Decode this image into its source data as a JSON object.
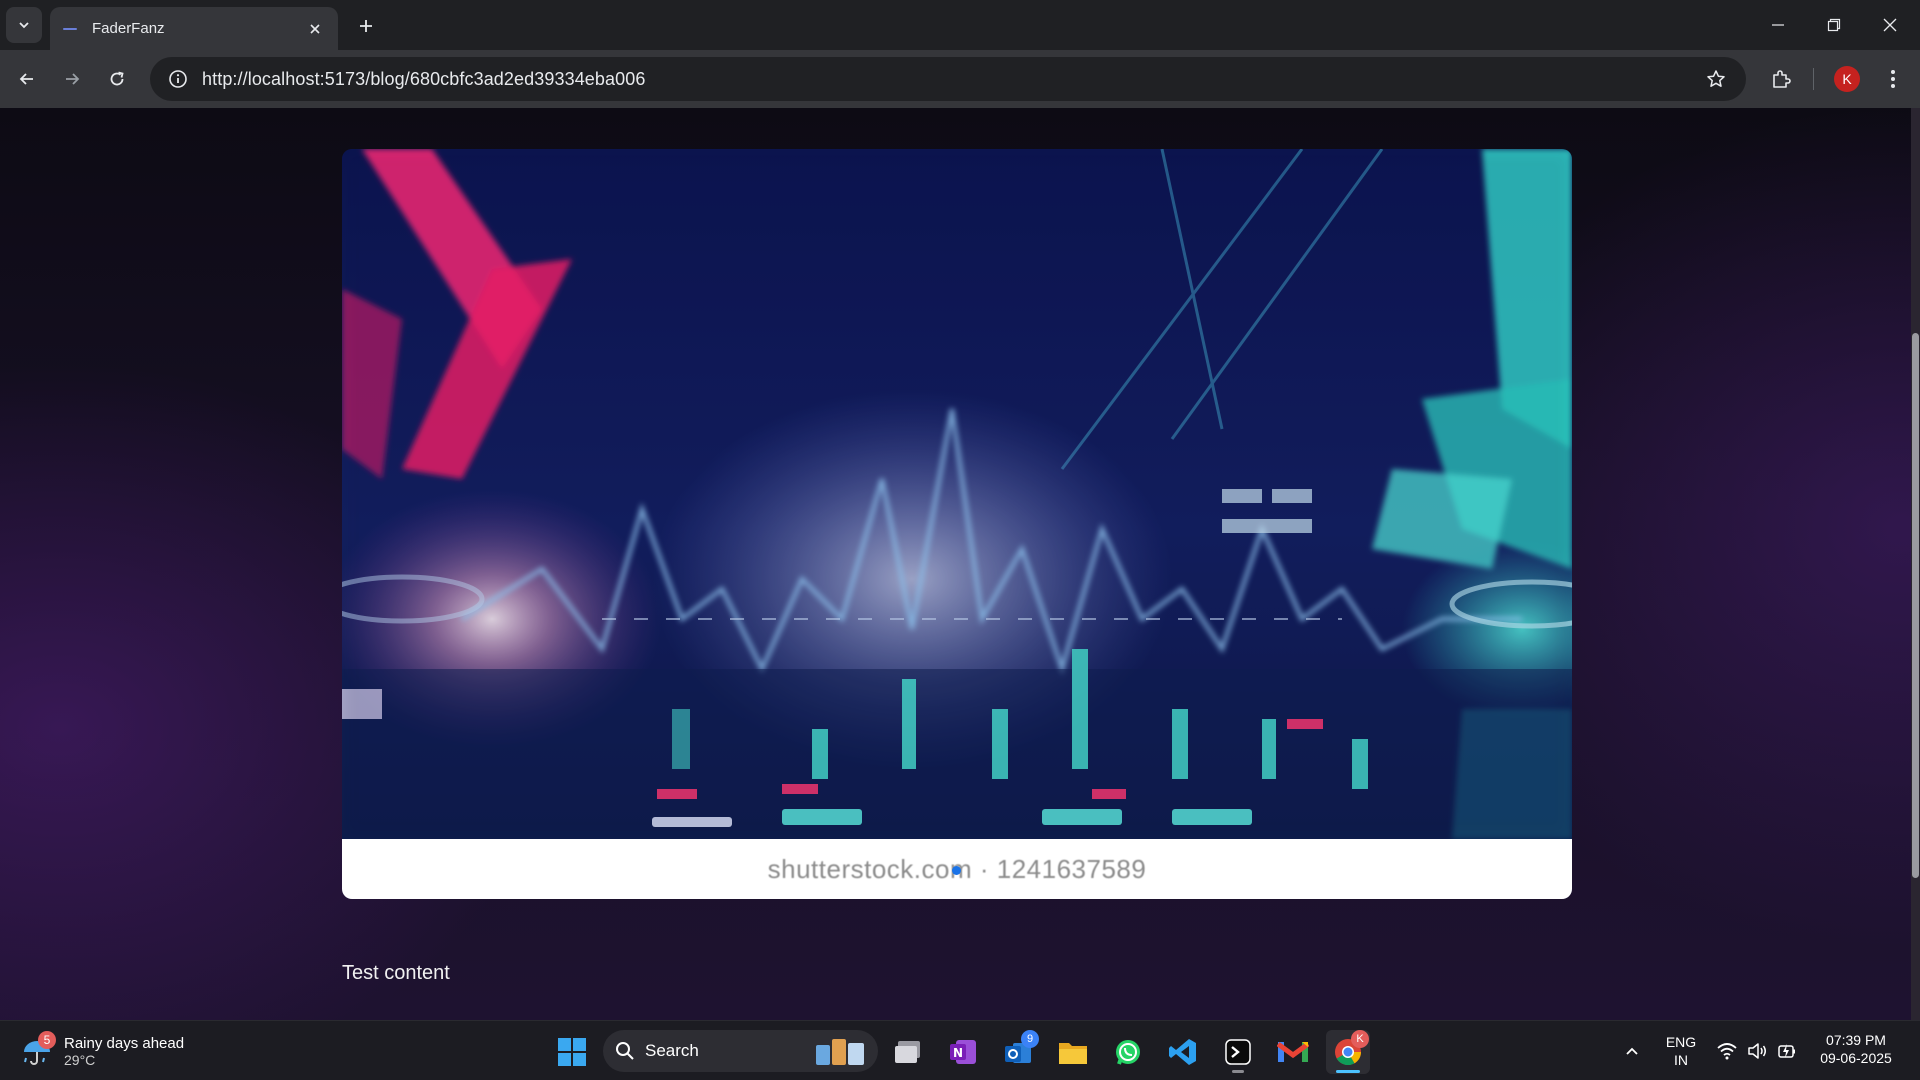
{
  "browser": {
    "tab_title": "FaderFanz",
    "url": "http://localhost:5173/blog/680cbfc3ad2ed39334eba006",
    "profile_initial": "K"
  },
  "post": {
    "image_caption": "shutterstock.com · 1241637589",
    "content": "Test content"
  },
  "taskbar": {
    "weather_badge": "5",
    "weather_title": "Rainy days ahead",
    "weather_temp": "29°C",
    "search_label": "Search",
    "outlook_badge": "9",
    "chrome_badge": "K",
    "language": "ENG",
    "region": "IN",
    "time": "07:39 PM",
    "date": "09-06-2025"
  },
  "colors": {
    "accent": "#1a73e8",
    "profile": "#c5221f",
    "page_bg": "#160f24"
  }
}
